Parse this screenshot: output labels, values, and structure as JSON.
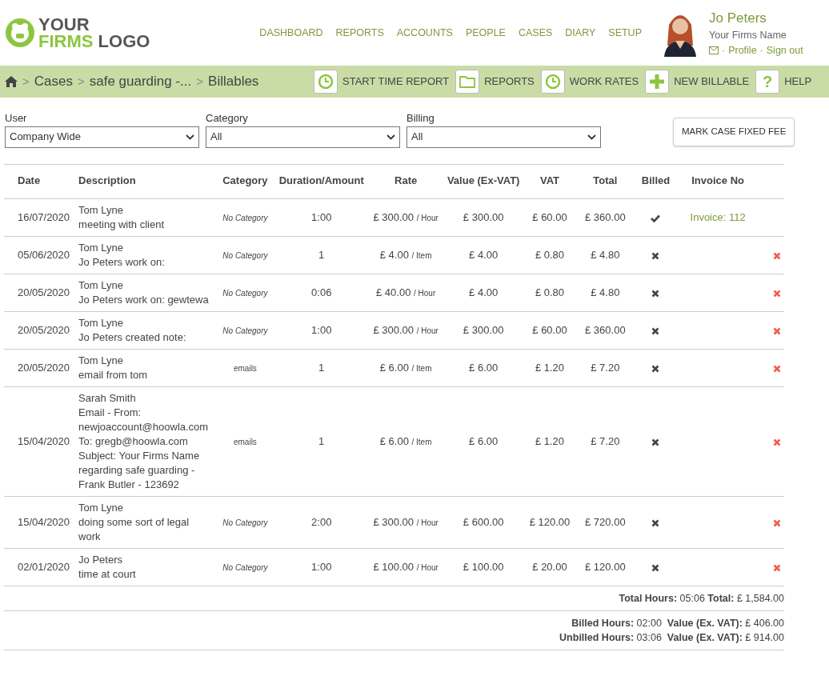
{
  "logo": {
    "line1": "YOUR",
    "line2_accent": "FIRMS",
    "line2_rest": "LOGO"
  },
  "nav": [
    "DASHBOARD",
    "REPORTS",
    "ACCOUNTS",
    "PEOPLE",
    "CASES",
    "DIARY",
    "SETUP"
  ],
  "user": {
    "name": "Jo Peters",
    "firm": "Your Firms Name",
    "links": [
      {
        "dot": "·",
        "label": "Profile"
      },
      {
        "dot": "·",
        "label": "Sign out"
      }
    ]
  },
  "breadcrumb": [
    {
      "separator": ">",
      "label": "Cases"
    },
    {
      "separator": ">",
      "label": "safe guarding -..."
    },
    {
      "separator": ">",
      "label": "Billables"
    }
  ],
  "toolbar": [
    {
      "label": "START TIME REPORT",
      "kind": "clock"
    },
    {
      "label": "REPORTS",
      "kind": "folder"
    },
    {
      "label": "WORK RATES",
      "kind": "clock"
    },
    {
      "label": "NEW BILLABLE",
      "kind": "plus"
    },
    {
      "label": "HELP",
      "kind": "question",
      "glyph": "?"
    }
  ],
  "filters": [
    {
      "label": "User",
      "value": "Company Wide"
    },
    {
      "label": "Category",
      "value": "All"
    },
    {
      "label": "Billing",
      "value": "All"
    }
  ],
  "fixed_fee_button": "MARK CASE FIXED FEE",
  "table": {
    "columns": [
      "Date",
      "Description",
      "Category",
      "Duration/Amount",
      "Rate",
      "Value (Ex-VAT)",
      "VAT",
      "Total",
      "Billed",
      "Invoice No"
    ],
    "rows": [
      {
        "date": "16/07/2020",
        "description": [
          "Tom Lyne",
          "meeting with client"
        ],
        "category": "No Category",
        "italic": true,
        "duration": "1:00",
        "rate": "£ 300.00",
        "unit": "/ Hour",
        "value": "£ 300.00",
        "vat": "£ 60.00",
        "total": "£ 360.00",
        "billed": true,
        "invoice": "Invoice: 112"
      },
      {
        "date": "05/06/2020",
        "description": [
          "Tom Lyne",
          "Jo Peters work on:"
        ],
        "category": "No Category",
        "italic": true,
        "duration": "1",
        "rate": "£ 4.00",
        "unit": "/ Item",
        "value": "£ 4.00",
        "vat": "£ 0.80",
        "total": "£ 4.80",
        "billed": false
      },
      {
        "date": "20/05/2020",
        "description": [
          "Tom Lyne",
          "Jo Peters work on: gewtewa"
        ],
        "category": "No Category",
        "italic": true,
        "duration": "0:06",
        "rate": "£ 40.00",
        "unit": "/ Hour",
        "value": "£ 4.00",
        "vat": "£ 0.80",
        "total": "£ 4.80",
        "billed": false
      },
      {
        "date": "20/05/2020",
        "description": [
          "Tom Lyne",
          "Jo Peters created note:"
        ],
        "category": "No Category",
        "italic": true,
        "duration": "1:00",
        "rate": "£ 300.00",
        "unit": "/ Hour",
        "value": "£ 300.00",
        "vat": "£ 60.00",
        "total": "£ 360.00",
        "billed": false
      },
      {
        "date": "20/05/2020",
        "description": [
          "Tom Lyne",
          "email from tom"
        ],
        "category": "emails",
        "italic": false,
        "duration": "1",
        "rate": "£ 6.00",
        "unit": "/ Item",
        "value": "£ 6.00",
        "vat": "£ 1.20",
        "total": "£ 7.20",
        "billed": false
      },
      {
        "date": "15/04/2020",
        "description": [
          "Sarah Smith",
          "Email - From: newjoaccount@hoowla.com",
          "To: gregb@hoowla.com",
          "Subject: Your Firms Name regarding safe guarding - Frank Butler - 123692"
        ],
        "category": "emails",
        "italic": false,
        "duration": "1",
        "rate": "£ 6.00",
        "unit": "/ Item",
        "value": "£ 6.00",
        "vat": "£ 1.20",
        "total": "£ 7.20",
        "billed": false
      },
      {
        "date": "15/04/2020",
        "description": [
          "Tom Lyne",
          "doing some sort of legal work"
        ],
        "category": "No Category",
        "italic": true,
        "duration": "2:00",
        "rate": "£ 300.00",
        "unit": "/ Hour",
        "value": "£ 600.00",
        "vat": "£ 120.00",
        "total": "£ 720.00",
        "billed": false
      },
      {
        "date": "02/01/2020",
        "description": [
          "Jo Peters",
          "time at court"
        ],
        "category": "No Category",
        "italic": true,
        "duration": "1:00",
        "rate": "£ 100.00",
        "unit": "/ Hour",
        "value": "£ 100.00",
        "vat": "£ 20.00",
        "total": "£ 120.00",
        "billed": false
      }
    ]
  },
  "totals": [
    "**Total Hours:** 05:06 **Total:** £ 1,584.00"
  ],
  "summary": [
    "**Billed Hours:** 02:00  **Value (Ex. VAT):** £ 406.00",
    "**Unbilled Hours:** 03:06  **Value (Ex. VAT):** £ 914.00"
  ]
}
